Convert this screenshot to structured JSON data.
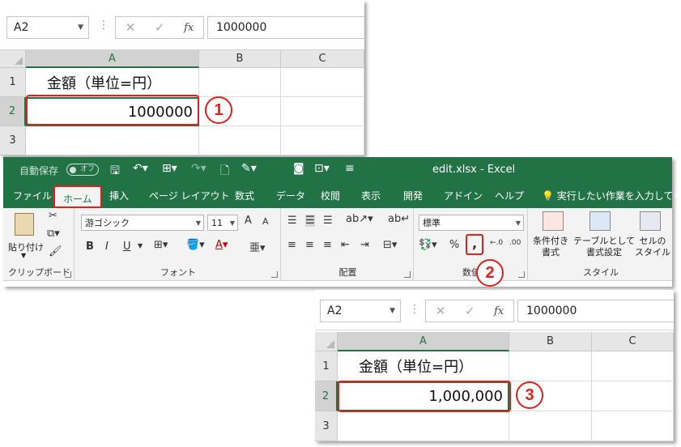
{
  "colors": {
    "excel_green": "#217346",
    "highlight_red": "#e0201b"
  },
  "top_sheet": {
    "namebox": "A2",
    "formula_value": "1000000",
    "fx_label": "fx",
    "columns": [
      "A",
      "B",
      "C"
    ],
    "rows": [
      "1",
      "2",
      "3"
    ],
    "cell_a1": "金額（単位=円）",
    "cell_a2": "1000000",
    "step_badge": "1"
  },
  "excel": {
    "autosave": "自動保存",
    "autosave_state": "オフ",
    "doc_title": "edit.xlsx  -  Excel",
    "tabs": [
      "ファイル",
      "ホーム",
      "挿入",
      "ページ レイアウト",
      "数式",
      "データ",
      "校閲",
      "表示",
      "開発",
      "アドイン",
      "ヘルプ"
    ],
    "tell_me": "実行したい作業を入力してくだ",
    "clipboard": {
      "paste": "貼り付け",
      "label": "クリップボード"
    },
    "font": {
      "name": "游ゴシック",
      "size": "11",
      "bold": "B",
      "italic": "I",
      "underline": "U",
      "label": "フォント",
      "grow": "A",
      "shrink": "A",
      "color_a": "A"
    },
    "alignment": {
      "label": "配置"
    },
    "number": {
      "format": "標準",
      "percent": "%",
      "comma": ",",
      "label": "数値",
      "step_badge": "2"
    },
    "styles": {
      "conditional": "条件付き\n書式",
      "table": "テーブルとして\n書式設定",
      "cell": "セルの\nスタイル",
      "label": "スタイル"
    }
  },
  "bottom_sheet": {
    "namebox": "A2",
    "formula_value": "1000000",
    "fx_label": "fx",
    "columns": [
      "A",
      "B",
      "C"
    ],
    "rows": [
      "1",
      "2",
      "3"
    ],
    "cell_a1": "金額（単位=円）",
    "cell_a2": "1,000,000",
    "step_badge": "3"
  }
}
